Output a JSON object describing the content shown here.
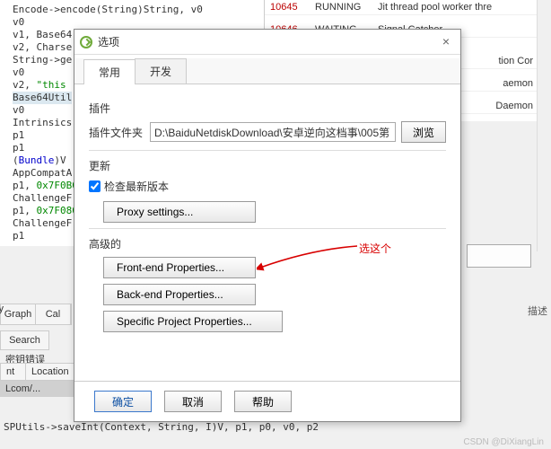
{
  "background": {
    "code_lines": [
      {
        "t": "Encode->encode(String)String, v0",
        "hl": false
      },
      {
        "t": "v0",
        "hl": false,
        "indent": "t"
      },
      {
        "t": "v1, Base64",
        "hl": false,
        "indent": "t"
      },
      {
        "t": "v2, Charse",
        "hl": false,
        "indent": "t"
      },
      {
        "t": "String->ge",
        "hl": false,
        "indent": "t"
      },
      {
        "t": "v0",
        "hl": false,
        "indent": "t"
      },
      {
        "t": "v2, \"this ",
        "hl": false,
        "indent": "t",
        "str": true
      },
      {
        "t": "Base64Util",
        "hl": true,
        "indent": "t"
      },
      {
        "t": "v0",
        "hl": false,
        "indent": "t"
      },
      {
        "t": "Intrinsics",
        "hl": false,
        "indent": "t"
      },
      {
        "t": "p1",
        "hl": false,
        "indent": "t"
      },
      {
        "t": "p1",
        "hl": false,
        "indent": "t"
      },
      {
        "t": "",
        "hl": false
      },
      {
        "t": "(Bundle)V",
        "hl": false,
        "type": true
      },
      {
        "t": "",
        "hl": false
      },
      {
        "t": "AppCompatA",
        "hl": false,
        "indent": "t"
      },
      {
        "t": "p1, 0x7F0B0",
        "hl": false,
        "indent": "t",
        "num": true
      },
      {
        "t": "ChallengeF",
        "hl": false,
        "indent": "t"
      },
      {
        "t": "p1, 0x7F080",
        "hl": false,
        "indent": "t",
        "num": true
      },
      {
        "t": "ChallengeF",
        "hl": false,
        "indent": "t"
      },
      {
        "t": "p1",
        "hl": false,
        "indent": "t"
      }
    ],
    "threads": [
      {
        "id": "10645",
        "state": "RUNNING",
        "name": "Jit thread pool worker thre"
      },
      {
        "id": "10646",
        "state": "WAITING",
        "name": "Signal Catcher"
      },
      {
        "id": "",
        "state": "",
        "name": "tion Cor"
      },
      {
        "id": "",
        "state": "",
        "name": "aemon"
      },
      {
        "id": "",
        "state": "",
        "name": "Daemon"
      }
    ],
    "toolbar": {
      "oply": "ply",
      "graph": "Graph",
      "cal": "Cal"
    },
    "search": "Search",
    "desc": "描述",
    "err_label": "密钥错误",
    "table_hdr": {
      "c1": "nt",
      "c2": "Location"
    },
    "table_cell": "Lcom/...",
    "status": "SPUtils->saveInt(Context, String, I)V, p1, p0, v0, p2",
    "watermark": "CSDN @DiXiangLin"
  },
  "dialog": {
    "title": "选项",
    "tabs": {
      "general": "常用",
      "dev": "开发"
    },
    "plugin": {
      "section": "插件",
      "folder_label": "插件文件夹",
      "folder_value": "D:\\BaiduNetdiskDownload\\安卓逆向这档事\\005第",
      "browse": "浏览"
    },
    "update": {
      "section": "更新",
      "check_label": "检查最新版本",
      "proxy_btn": "Proxy settings..."
    },
    "advanced": {
      "section": "高级的",
      "front": "Front-end Properties...",
      "back": "Back-end Properties...",
      "specific": "Specific Project Properties..."
    },
    "footer": {
      "ok": "确定",
      "cancel": "取消",
      "help": "帮助"
    }
  },
  "annotation": {
    "text": "选这个"
  }
}
